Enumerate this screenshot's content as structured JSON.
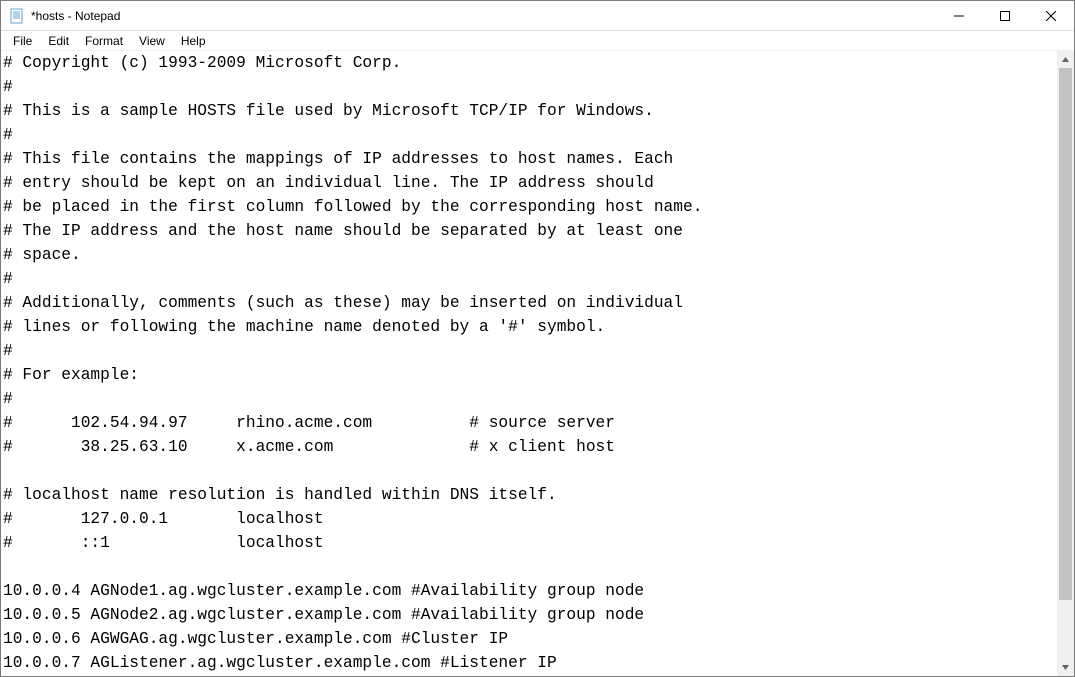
{
  "window": {
    "title": "*hosts - Notepad"
  },
  "menu": {
    "file": "File",
    "edit": "Edit",
    "format": "Format",
    "view": "View",
    "help": "Help"
  },
  "content": "# Copyright (c) 1993-2009 Microsoft Corp.\n#\n# This is a sample HOSTS file used by Microsoft TCP/IP for Windows.\n#\n# This file contains the mappings of IP addresses to host names. Each\n# entry should be kept on an individual line. The IP address should\n# be placed in the first column followed by the corresponding host name.\n# The IP address and the host name should be separated by at least one\n# space.\n#\n# Additionally, comments (such as these) may be inserted on individual\n# lines or following the machine name denoted by a '#' symbol.\n#\n# For example:\n#\n#      102.54.94.97     rhino.acme.com          # source server\n#       38.25.63.10     x.acme.com              # x client host\n\n# localhost name resolution is handled within DNS itself.\n#       127.0.0.1       localhost\n#       ::1             localhost\n\n10.0.0.4 AGNode1.ag.wgcluster.example.com #Availability group node\n10.0.0.5 AGNode2.ag.wgcluster.example.com #Availability group node\n10.0.0.6 AGWGAG.ag.wgcluster.example.com #Cluster IP\n10.0.0.7 AGListener.ag.wgcluster.example.com #Listener IP"
}
